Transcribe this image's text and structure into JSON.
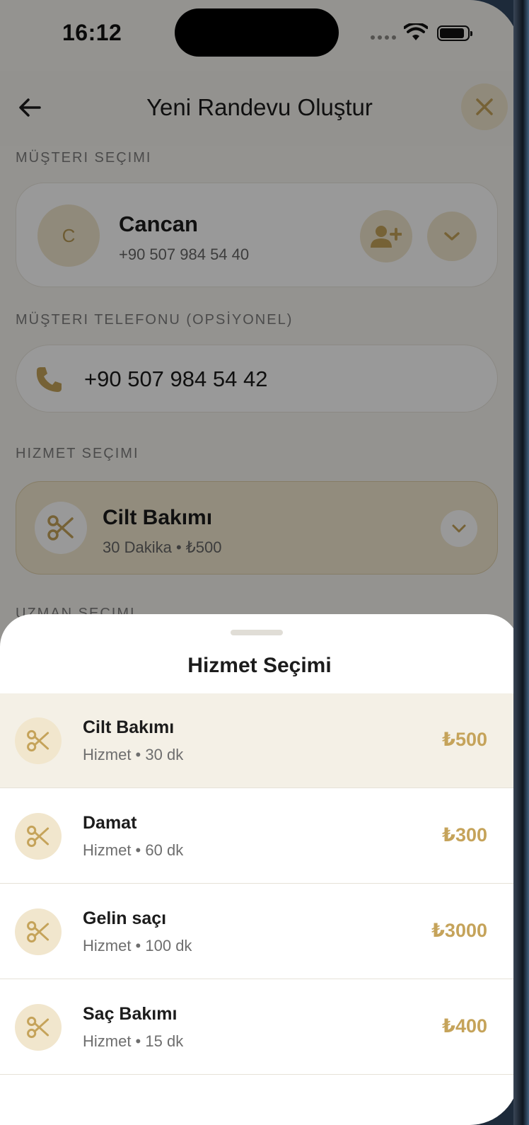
{
  "status_bar": {
    "time": "16:12"
  },
  "header": {
    "title": "Yeni Randevu Oluştur"
  },
  "customer_section": {
    "label": "MÜŞTERI SEÇIMI",
    "initial": "C",
    "name": "Cancan",
    "phone": "+90 507 984 54 40"
  },
  "phone_section": {
    "label": "MÜŞTERI TELEFONU (OPSİYONEL)",
    "value": "+90 507 984 54 42"
  },
  "service_section": {
    "label": "HIZMET SEÇIMI",
    "selected_name": "Cilt Bakımı",
    "selected_sub": "30 Dakika • ₺500"
  },
  "expert_section": {
    "label": "UZMAN SEÇIMI"
  },
  "sheet": {
    "title": "Hizmet Seçimi",
    "items": [
      {
        "name": "Cilt Bakımı",
        "meta": "Hizmet • 30 dk",
        "price": "₺500",
        "selected": true
      },
      {
        "name": "Damat",
        "meta": "Hizmet • 60 dk",
        "price": "₺300",
        "selected": false
      },
      {
        "name": "Gelin saçı",
        "meta": "Hizmet • 100 dk",
        "price": "₺3000",
        "selected": false
      },
      {
        "name": "Saç Bakımı",
        "meta": "Hizmet • 15 dk",
        "price": "₺400",
        "selected": false
      }
    ]
  },
  "colors": {
    "accent": "#c5a35a",
    "accent_light": "#f1e6cd",
    "selected_row": "#f4f0e6"
  },
  "icons": [
    "arrow-left-icon",
    "close-icon",
    "user-plus-icon",
    "chevron-down-icon",
    "phone-icon",
    "scissors-icon"
  ]
}
